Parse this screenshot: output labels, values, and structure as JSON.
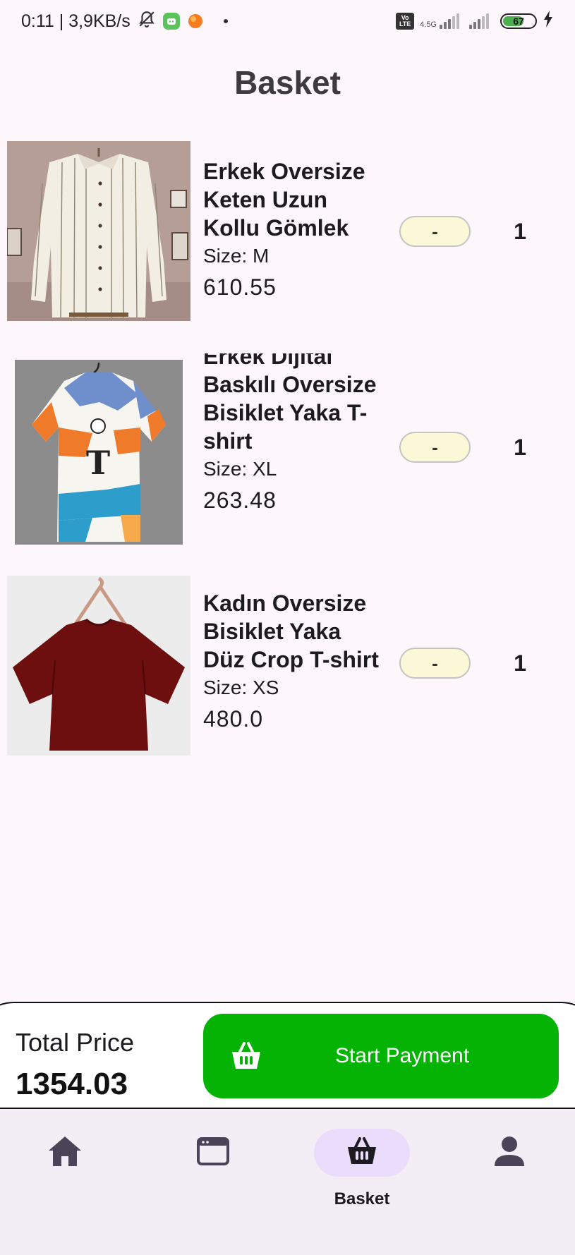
{
  "status_bar": {
    "time_speed": "0:11 | 3,9KB/s",
    "network_type": "4.5G",
    "volte": "Vo LTE",
    "battery": "67"
  },
  "header": {
    "title": "Basket"
  },
  "items": [
    {
      "name": "Erkek Oversize Keten Uzun Kollu Gömlek",
      "size": "Size: M",
      "price": "610.55",
      "minus_label": "-",
      "quantity": "1"
    },
    {
      "name": "Erkek Dijital Baskılı Oversize Bisiklet Yaka T-shirt",
      "size": "Size: XL",
      "price": "263.48",
      "minus_label": "-",
      "quantity": "1"
    },
    {
      "name": "Kadın Oversize Bisiklet Yaka Düz Crop T-shirt",
      "size": "Size: XS",
      "price": "480.0",
      "minus_label": "-",
      "quantity": "1"
    }
  ],
  "checkout": {
    "total_label": "Total Price",
    "total_value": "1354.03",
    "pay_button_label": "Start Payment",
    "pay_button_color": "#04b304"
  },
  "bottom_nav": {
    "items": [
      {
        "icon": "home-icon",
        "label": ""
      },
      {
        "icon": "browser-window-icon",
        "label": ""
      },
      {
        "icon": "basket-icon",
        "label": "Basket",
        "active": true
      },
      {
        "icon": "person-icon",
        "label": ""
      }
    ]
  }
}
